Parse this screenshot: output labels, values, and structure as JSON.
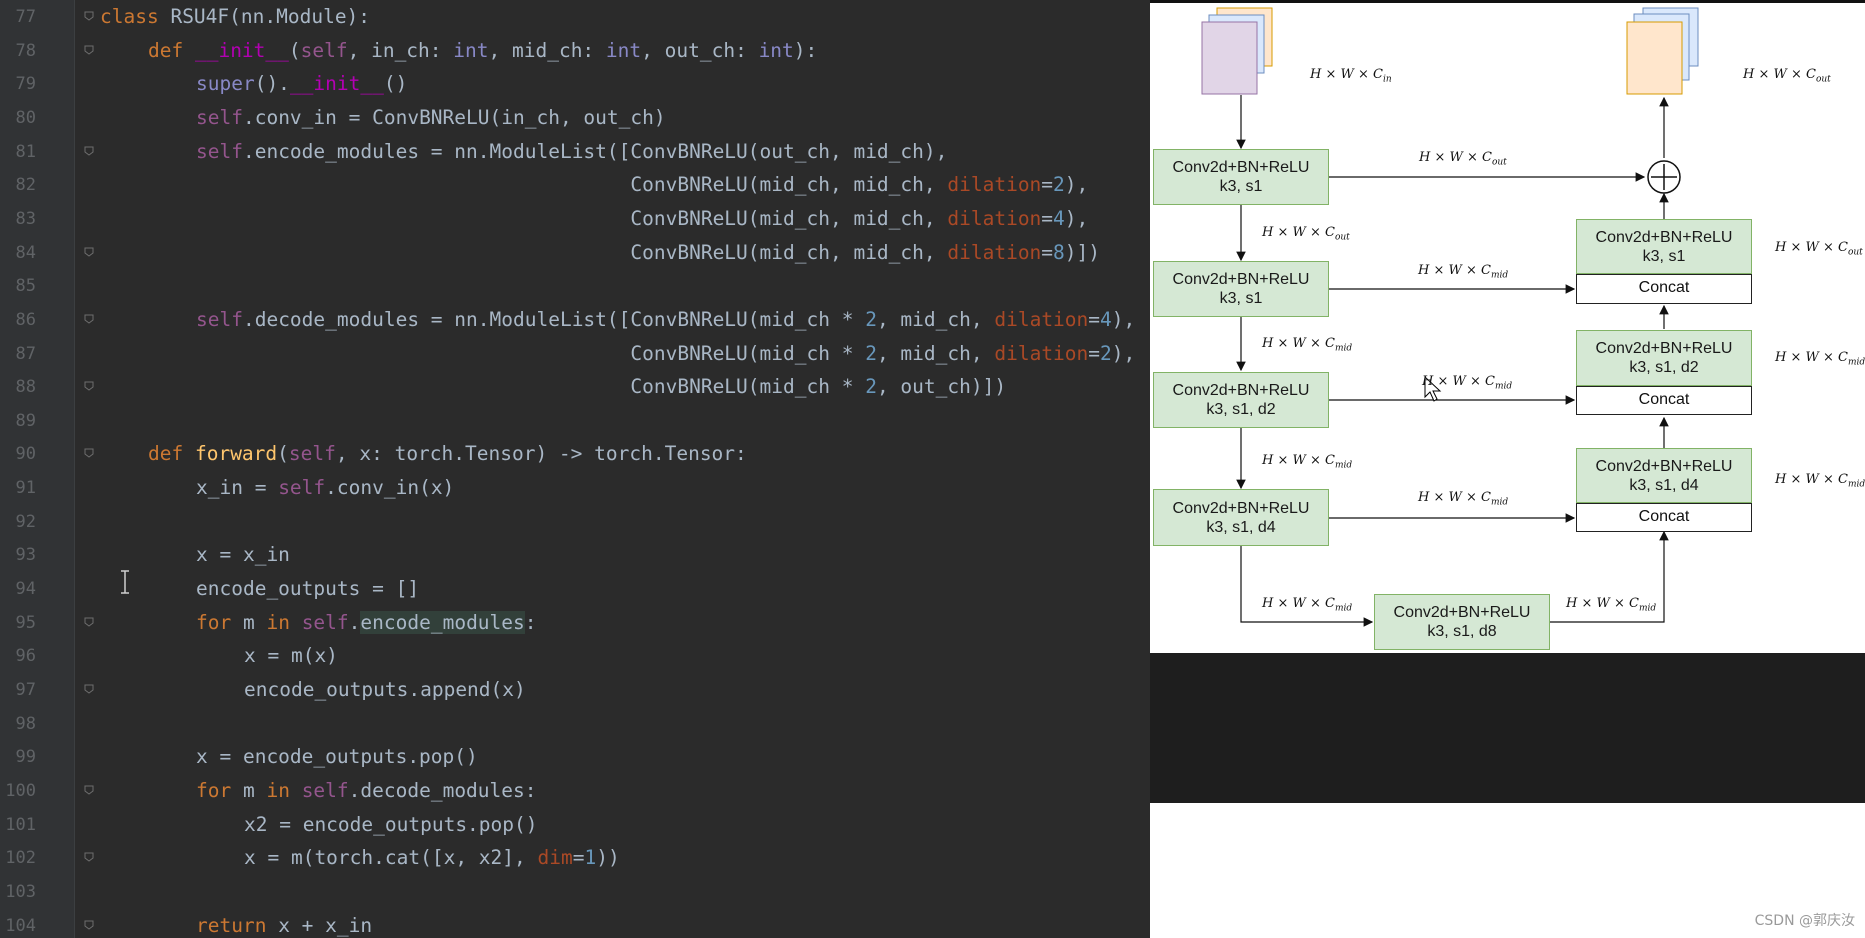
{
  "editor": {
    "lines": [
      {
        "no": "77",
        "indent": 0,
        "tokens": [
          {
            "t": "class ",
            "c": "kw"
          },
          {
            "t": "RSU4F(nn.Module):",
            "c": ""
          }
        ]
      },
      {
        "no": "78",
        "indent": 1,
        "tokens": [
          {
            "t": "def ",
            "c": "kw"
          },
          {
            "t": "__init__",
            "c": "mg"
          },
          {
            "t": "(",
            "c": ""
          },
          {
            "t": "self",
            "c": "self"
          },
          {
            "t": ", in_ch: ",
            "c": ""
          },
          {
            "t": "int",
            "c": "tp"
          },
          {
            "t": ", mid_ch: ",
            "c": ""
          },
          {
            "t": "int",
            "c": "tp"
          },
          {
            "t": ", out_ch: ",
            "c": ""
          },
          {
            "t": "int",
            "c": "tp"
          },
          {
            "t": "):",
            "c": ""
          }
        ]
      },
      {
        "no": "79",
        "indent": 2,
        "tokens": [
          {
            "t": "super",
            "c": "tp"
          },
          {
            "t": "().",
            "c": ""
          },
          {
            "t": "__init__",
            "c": "mg"
          },
          {
            "t": "()",
            "c": ""
          }
        ]
      },
      {
        "no": "80",
        "indent": 2,
        "tokens": [
          {
            "t": "self",
            "c": "self"
          },
          {
            "t": ".conv_in = ConvBNReLU(in_ch, out_ch)",
            "c": ""
          }
        ]
      },
      {
        "no": "81",
        "indent": 2,
        "tokens": [
          {
            "t": "self",
            "c": "self"
          },
          {
            "t": ".encode_modules = nn.ModuleList([ConvBNReLU(out_ch, mid_ch),",
            "c": ""
          }
        ]
      },
      {
        "no": "82",
        "indent": 2,
        "pad": "                                     ",
        "tokens": [
          {
            "t": "ConvBNReLU(mid_ch, mid_ch, ",
            "c": ""
          },
          {
            "t": "dilation",
            "c": "kwarg"
          },
          {
            "t": "=",
            "c": ""
          },
          {
            "t": "2",
            "c": "num"
          },
          {
            "t": "),",
            "c": ""
          }
        ]
      },
      {
        "no": "83",
        "indent": 2,
        "pad": "                                     ",
        "tokens": [
          {
            "t": "ConvBNReLU(mid_ch, mid_ch, ",
            "c": ""
          },
          {
            "t": "dilation",
            "c": "kwarg"
          },
          {
            "t": "=",
            "c": ""
          },
          {
            "t": "4",
            "c": "num"
          },
          {
            "t": "),",
            "c": ""
          }
        ]
      },
      {
        "no": "84",
        "indent": 2,
        "pad": "                                     ",
        "tokens": [
          {
            "t": "ConvBNReLU(mid_ch, mid_ch, ",
            "c": ""
          },
          {
            "t": "dilation",
            "c": "kwarg"
          },
          {
            "t": "=",
            "c": ""
          },
          {
            "t": "8",
            "c": "num"
          },
          {
            "t": ")])",
            "c": ""
          }
        ]
      },
      {
        "no": "85",
        "indent": 0,
        "tokens": []
      },
      {
        "no": "86",
        "indent": 2,
        "tokens": [
          {
            "t": "self",
            "c": "self"
          },
          {
            "t": ".decode_modules = nn.ModuleList([ConvBNReLU(mid_ch * ",
            "c": ""
          },
          {
            "t": "2",
            "c": "num"
          },
          {
            "t": ", mid_ch, ",
            "c": ""
          },
          {
            "t": "dilation",
            "c": "kwarg"
          },
          {
            "t": "=",
            "c": ""
          },
          {
            "t": "4",
            "c": "num"
          },
          {
            "t": "),",
            "c": ""
          }
        ]
      },
      {
        "no": "87",
        "indent": 2,
        "pad": "                                     ",
        "tokens": [
          {
            "t": "ConvBNReLU(mid_ch * ",
            "c": ""
          },
          {
            "t": "2",
            "c": "num"
          },
          {
            "t": ", mid_ch, ",
            "c": ""
          },
          {
            "t": "dilation",
            "c": "kwarg"
          },
          {
            "t": "=",
            "c": ""
          },
          {
            "t": "2",
            "c": "num"
          },
          {
            "t": "),",
            "c": ""
          }
        ]
      },
      {
        "no": "88",
        "indent": 2,
        "pad": "                                     ",
        "tokens": [
          {
            "t": "ConvBNReLU(mid_ch * ",
            "c": ""
          },
          {
            "t": "2",
            "c": "num"
          },
          {
            "t": ", out_ch)])",
            "c": ""
          }
        ]
      },
      {
        "no": "89",
        "indent": 0,
        "tokens": []
      },
      {
        "no": "90",
        "indent": 1,
        "tokens": [
          {
            "t": "def ",
            "c": "kw"
          },
          {
            "t": "forward",
            "c": "fn"
          },
          {
            "t": "(",
            "c": ""
          },
          {
            "t": "self",
            "c": "self"
          },
          {
            "t": ", x: torch.Tensor) -> torch.Tensor:",
            "c": ""
          }
        ]
      },
      {
        "no": "91",
        "indent": 2,
        "tokens": [
          {
            "t": "x_in = ",
            "c": ""
          },
          {
            "t": "self",
            "c": "self"
          },
          {
            "t": ".conv_in(x)",
            "c": ""
          }
        ]
      },
      {
        "no": "92",
        "indent": 0,
        "tokens": []
      },
      {
        "no": "93",
        "indent": 2,
        "tokens": [
          {
            "t": "x = x_in",
            "c": ""
          }
        ]
      },
      {
        "no": "94",
        "indent": 2,
        "tokens": [
          {
            "t": "encode_outputs = []",
            "c": ""
          }
        ]
      },
      {
        "no": "95",
        "indent": 2,
        "tokens": [
          {
            "t": "for ",
            "c": "kw"
          },
          {
            "t": "m ",
            "c": ""
          },
          {
            "t": "in ",
            "c": "kw"
          },
          {
            "t": "self",
            "c": "self"
          },
          {
            "t": ".",
            "c": ""
          },
          {
            "t": "encode_modules",
            "c": "hl"
          },
          {
            "t": ":",
            "c": ""
          }
        ]
      },
      {
        "no": "96",
        "indent": 3,
        "tokens": [
          {
            "t": "x = m(x)",
            "c": ""
          }
        ]
      },
      {
        "no": "97",
        "indent": 3,
        "tokens": [
          {
            "t": "encode_outputs.append(x)",
            "c": ""
          }
        ]
      },
      {
        "no": "98",
        "indent": 0,
        "tokens": []
      },
      {
        "no": "99",
        "indent": 2,
        "tokens": [
          {
            "t": "x = encode_outputs.pop()",
            "c": ""
          }
        ]
      },
      {
        "no": "100",
        "indent": 2,
        "tokens": [
          {
            "t": "for ",
            "c": "kw"
          },
          {
            "t": "m ",
            "c": ""
          },
          {
            "t": "in ",
            "c": "kw"
          },
          {
            "t": "self",
            "c": "self"
          },
          {
            "t": ".decode_modules:",
            "c": ""
          }
        ]
      },
      {
        "no": "101",
        "indent": 3,
        "tokens": [
          {
            "t": "x2 = encode_outputs.pop()",
            "c": ""
          }
        ]
      },
      {
        "no": "102",
        "indent": 3,
        "tokens": [
          {
            "t": "x = m(torch.cat([x, x2], ",
            "c": ""
          },
          {
            "t": "dim",
            "c": "kwarg"
          },
          {
            "t": "=",
            "c": ""
          },
          {
            "t": "1",
            "c": "num"
          },
          {
            "t": "))",
            "c": ""
          }
        ]
      },
      {
        "no": "103",
        "indent": 0,
        "tokens": []
      },
      {
        "no": "104",
        "indent": 2,
        "tokens": [
          {
            "t": "return ",
            "c": "kw"
          },
          {
            "t": "x + x_in",
            "c": ""
          }
        ]
      }
    ],
    "fold_lines": [
      "77",
      "78",
      "81",
      "84",
      "86",
      "88",
      "90",
      "95",
      "97",
      "100",
      "102",
      "104"
    ]
  },
  "diagram": {
    "enc1": {
      "l1": "Conv2d+BN+ReLU",
      "l2": "k3, s1"
    },
    "enc2": {
      "l1": "Conv2d+BN+ReLU",
      "l2": "k3, s1"
    },
    "enc3": {
      "l1": "Conv2d+BN+ReLU",
      "l2": "k3, s1, d2"
    },
    "enc4": {
      "l1": "Conv2d+BN+ReLU",
      "l2": "k3, s1, d4"
    },
    "bottom": {
      "l1": "Conv2d+BN+ReLU",
      "l2": "k3, s1, d8"
    },
    "dec1": {
      "l1": "Conv2d+BN+ReLU",
      "l2": "k3, s1"
    },
    "dec2": {
      "l1": "Conv2d+BN+ReLU",
      "l2": "k3, s1, d2"
    },
    "dec3": {
      "l1": "Conv2d+BN+ReLU",
      "l2": "k3, s1, d4"
    },
    "concat": "Concat",
    "dim_in": {
      "base": "H × W × C",
      "sub": "in"
    },
    "dim_out": {
      "base": "H × W × C",
      "sub": "out"
    },
    "dim_mid": {
      "base": "H × W × C",
      "sub": "mid"
    }
  },
  "watermark": "CSDN @郭庆汝"
}
